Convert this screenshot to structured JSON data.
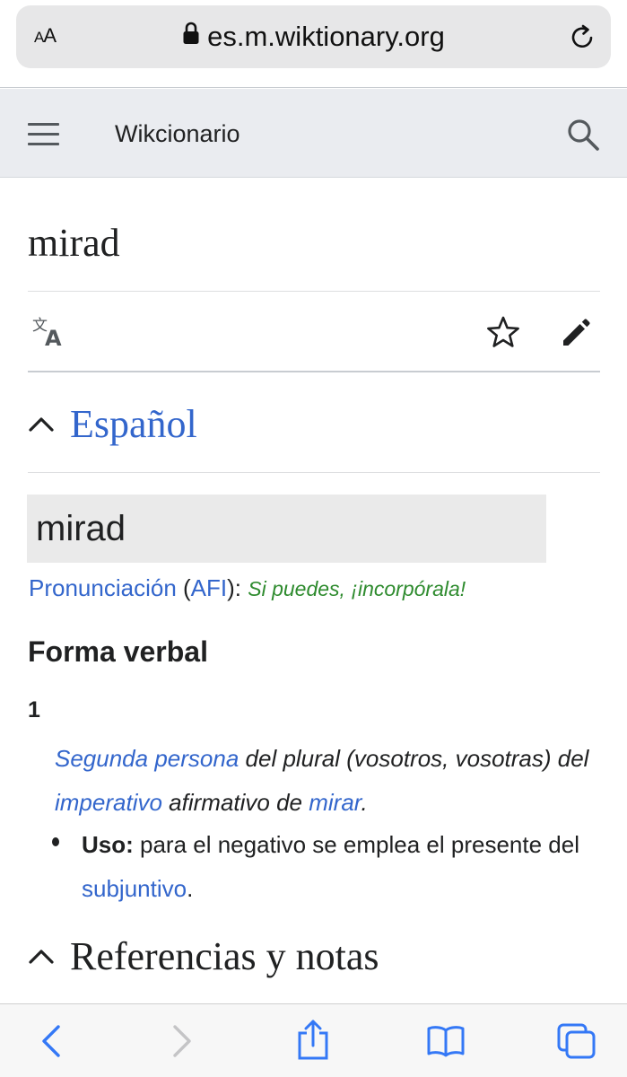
{
  "browser": {
    "text_size_label": "AA",
    "domain": "es.m.wiktionary.org",
    "accent": "#3478f6"
  },
  "header": {
    "site_name": "Wikcionario"
  },
  "page": {
    "title": "mirad"
  },
  "sections": {
    "espanol": {
      "heading": "Español",
      "headword": "mirad",
      "pronunciation": {
        "link_label": "Pronunciación",
        "open_paren": " (",
        "afi_label": "AFI",
        "close_paren": "):",
        "prompt": "Si puedes, ¡incorpórala!"
      },
      "subheading": "Forma verbal",
      "definition": {
        "number": "1",
        "link1": "Segunda persona",
        "text1": " del plural (vosotros, vosotras) del ",
        "link2": "imperativo",
        "text2": " afirmativo de ",
        "link3": "mirar",
        "text3": ".",
        "usage_label": "Uso:",
        "usage_text": " para el negativo se emplea el presente del ",
        "usage_link": "subjuntivo",
        "usage_end": "."
      }
    },
    "referencias": {
      "heading": "Referencias y notas"
    }
  },
  "colors": {
    "link": "#3366cc",
    "prompt_green": "#2e8b2e",
    "header_bg": "#eaecf0"
  }
}
